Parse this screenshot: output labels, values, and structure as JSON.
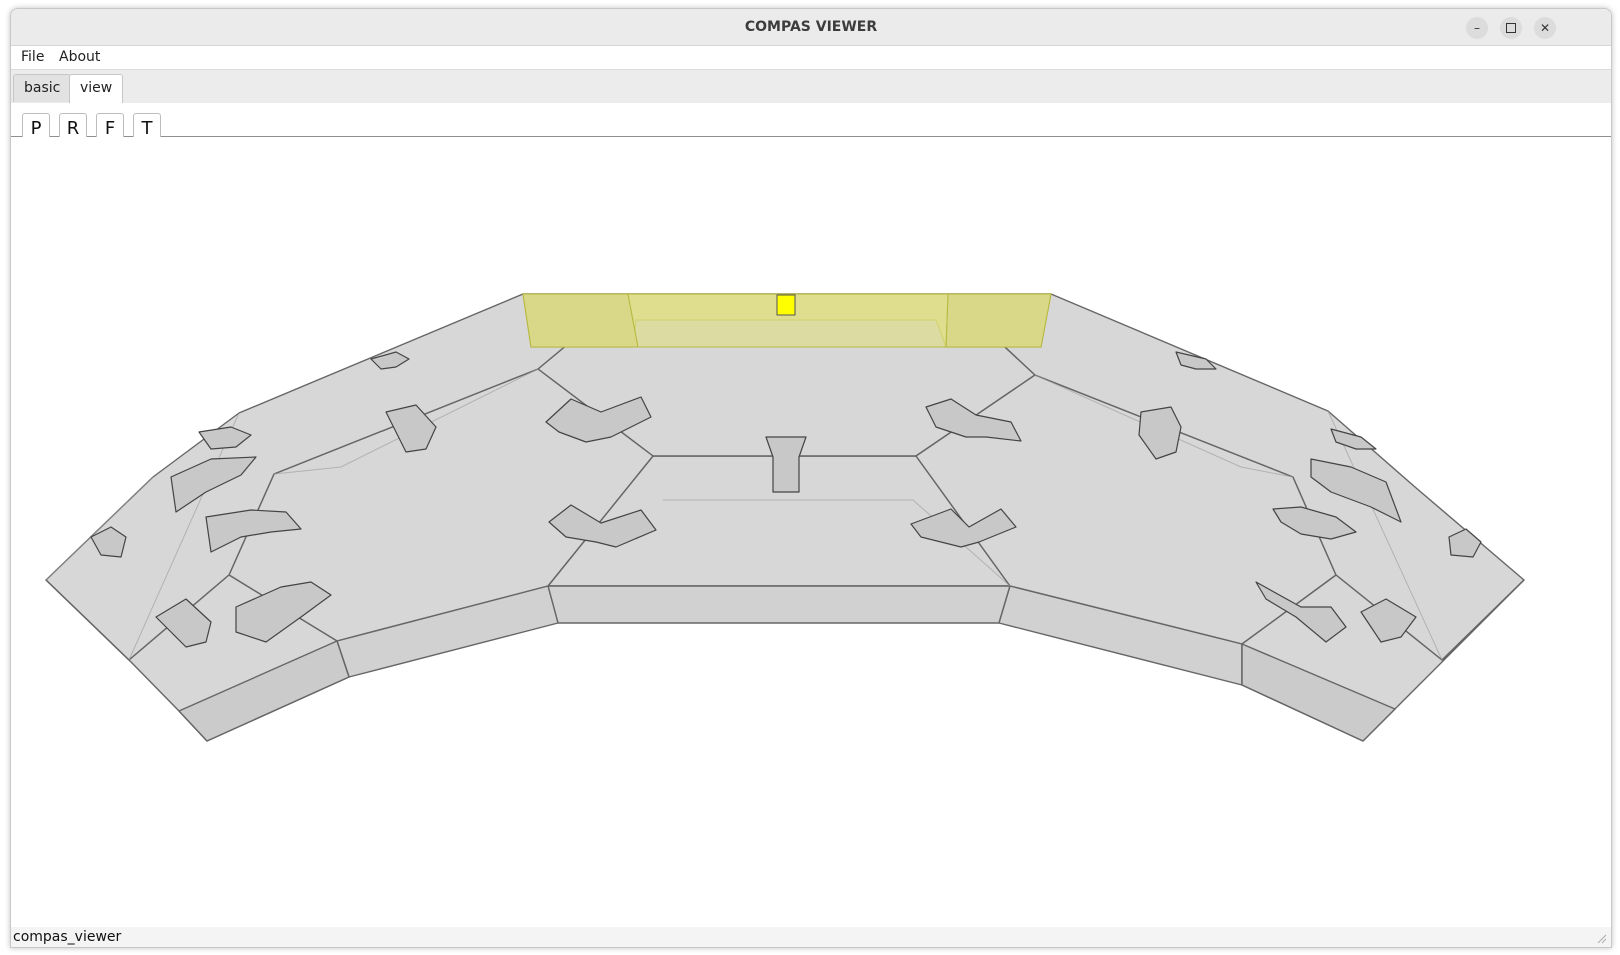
{
  "window": {
    "title": "COMPAS VIEWER",
    "controls": [
      "minimize-icon",
      "maximize-icon",
      "close-icon"
    ]
  },
  "menu": {
    "file": "File",
    "about": "About"
  },
  "tabs": [
    {
      "label": "basic",
      "active": false
    },
    {
      "label": "view",
      "active": true
    }
  ],
  "toolbar": {
    "buttons": [
      "P",
      "R",
      "F",
      "T"
    ]
  },
  "scene": {
    "object_color": "#d0d0d0",
    "edge_color": "#666666",
    "selected_color": "#dede8c",
    "highlight_color": "#ffff00"
  },
  "status": {
    "text": "compas_viewer"
  }
}
